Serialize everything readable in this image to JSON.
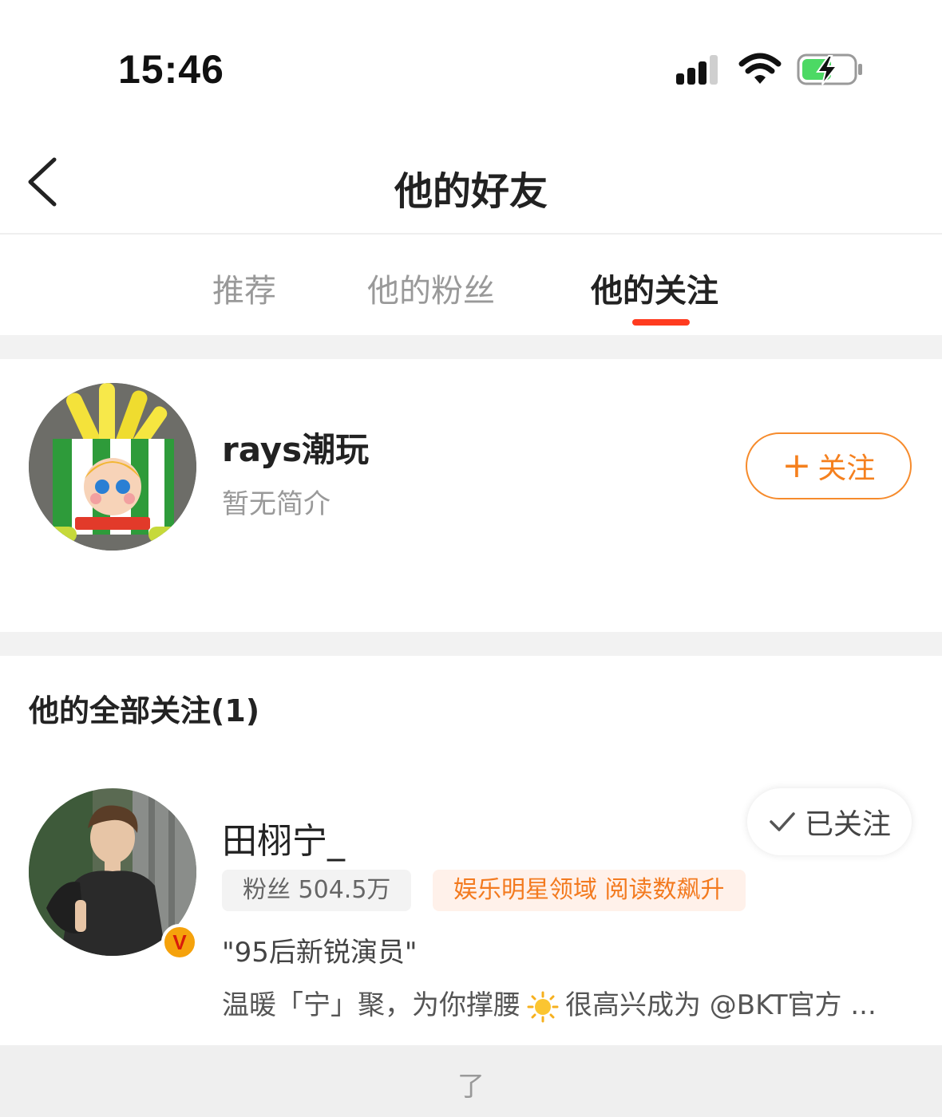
{
  "status": {
    "time": "15:46"
  },
  "nav": {
    "title": "他的好友"
  },
  "tabs": [
    {
      "label": "推荐",
      "active": false
    },
    {
      "label": "他的粉丝",
      "active": false
    },
    {
      "label": "他的关注",
      "active": true
    }
  ],
  "recommend": {
    "name": "rays潮玩",
    "desc": "暂无简介",
    "follow_label": "关注"
  },
  "section": {
    "title": "他的全部关注(1)"
  },
  "user": {
    "name": "田栩宁_",
    "followed_label": "已关注",
    "fans_tag": "粉丝 504.5万",
    "hot_tag": "娱乐明星领域 阅读数飙升",
    "intro": "\"95后新锐演员\"",
    "status_before": "温暖「宁」聚，为你撑腰",
    "status_after": "很高兴成为 @BKT官方 ...",
    "verified_badge": "V"
  },
  "footer": {
    "text": "了"
  },
  "colors": {
    "accent": "#ff3b1f",
    "follow_orange": "#f5801e",
    "battery_green": "#4cd964"
  }
}
